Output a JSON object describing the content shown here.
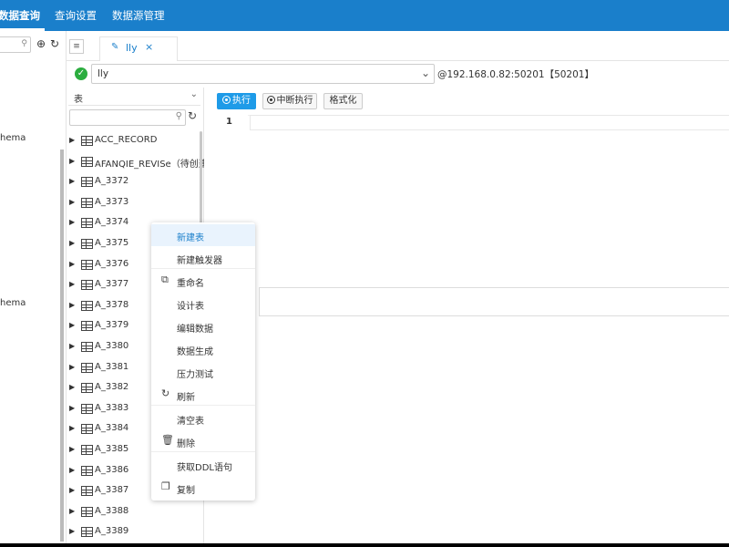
{
  "topnav": {
    "items": [
      {
        "label": "数据查询",
        "active": true
      },
      {
        "label": "查询设置",
        "active": false
      },
      {
        "label": "数据源管理",
        "active": false
      }
    ]
  },
  "left_panel": {
    "search_placeholder": "",
    "partial_labels": [
      "hema",
      "hema"
    ]
  },
  "tabs": [
    {
      "label": "lly",
      "close": "×"
    }
  ],
  "connection": {
    "status": "connected",
    "status_glyph": "✓",
    "selected": "lly",
    "host": "@192.168.0.82:50201【50201】"
  },
  "table_panel": {
    "type_label": "表",
    "search_placeholder": "",
    "items": [
      "ACC_RECORD",
      "AFANQIE_REVISe（待创建）",
      "A_3372",
      "A_3373",
      "A_3374",
      "A_3375",
      "A_3376",
      "A_3377",
      "A_3378",
      "A_3379",
      "A_3380",
      "A_3381",
      "A_3382",
      "A_3383",
      "A_3384",
      "A_3385",
      "A_3386",
      "A_3387",
      "A_3388",
      "A_3389"
    ]
  },
  "editor": {
    "run_label": "执行",
    "stop_label": "中断执行",
    "format_label": "格式化",
    "line_numbers": [
      "1"
    ]
  },
  "context_menu": {
    "items": [
      {
        "label": "新建表",
        "icon": "",
        "hover": true
      },
      {
        "label": "新建触发器",
        "icon": ""
      },
      {
        "label": "重命名",
        "icon": "rename-icon"
      },
      {
        "label": "设计表",
        "icon": ""
      },
      {
        "label": "编辑数据",
        "icon": ""
      },
      {
        "label": "数据生成",
        "icon": ""
      },
      {
        "label": "压力测试",
        "icon": ""
      },
      {
        "label": "刷新",
        "icon": "refresh-icon"
      },
      {
        "label": "清空表",
        "icon": ""
      },
      {
        "label": "删除",
        "icon": "trash-icon"
      },
      {
        "label": "获取DDL语句",
        "icon": ""
      },
      {
        "label": "复制",
        "icon": "copy-icon"
      }
    ]
  },
  "colors": {
    "topbar": "#1a7fcb",
    "primary_button": "#1e9be8",
    "status_ok": "#2bad3f"
  }
}
